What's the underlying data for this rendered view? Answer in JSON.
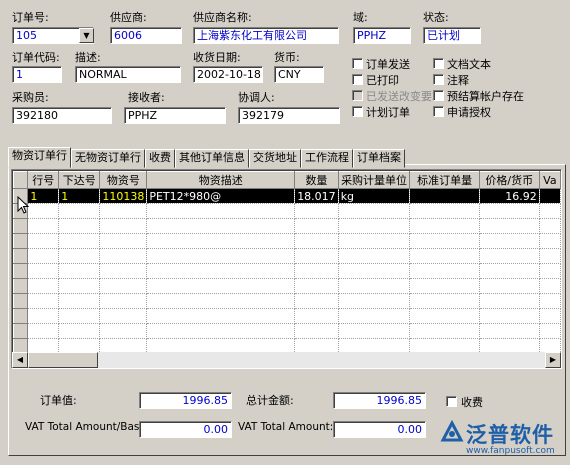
{
  "header": {
    "order_no": {
      "label": "订单号:",
      "value": "105"
    },
    "supplier": {
      "label": "供应商:",
      "value": "6006"
    },
    "supplier_name": {
      "label": "供应商名称:",
      "value": "上海紫东化工有限公司"
    },
    "domain": {
      "label": "域:",
      "value": "PPHZ"
    },
    "status": {
      "label": "状态:",
      "value": "已计划"
    },
    "order_code": {
      "label": "订单代码:",
      "value": "1"
    },
    "description": {
      "label": "描述:",
      "value": "NORMAL"
    },
    "receipt_date": {
      "label": "收货日期:",
      "value": "2002-10-18"
    },
    "currency": {
      "label": "货币:",
      "value": "CNY"
    },
    "buyer": {
      "label": "采购员:",
      "value": "392180"
    },
    "receiver": {
      "label": "接收者:",
      "value": "PPHZ"
    },
    "coordinator": {
      "label": "协调人:",
      "value": "392179"
    }
  },
  "checkboxes": [
    {
      "label": "订单发送",
      "checked": false,
      "disabled": false
    },
    {
      "label": "文档文本",
      "checked": false,
      "disabled": false
    },
    {
      "label": "已打印",
      "checked": false,
      "disabled": false
    },
    {
      "label": "注释",
      "checked": false,
      "disabled": false
    },
    {
      "label": "已发送改变要求",
      "checked": false,
      "disabled": true
    },
    {
      "label": "预结算帐户存在",
      "checked": false,
      "disabled": false
    },
    {
      "label": "计划订单",
      "checked": false,
      "disabled": false
    },
    {
      "label": "申请授权",
      "checked": false,
      "disabled": false
    }
  ],
  "tabs": [
    "物资订单行",
    "无物资订单行",
    "收费",
    "其他订单信息",
    "交货地址",
    "工作流程",
    "订单档案"
  ],
  "table": {
    "columns": [
      "行号",
      "下达号",
      "物资号",
      "物资描述",
      "数量",
      "采购计量单位",
      "标准订单量",
      "价格/货币",
      "Va"
    ],
    "rows": [
      [
        "1",
        "1",
        "110138",
        "PET12*980@",
        "18.017",
        "kg",
        "",
        "16.92",
        ""
      ]
    ]
  },
  "footer": {
    "order_value": {
      "label": "订单值:",
      "value": "1996.85"
    },
    "total_amount": {
      "label": "总计金额:",
      "value": "1996.85"
    },
    "charge": {
      "label": "收费"
    },
    "vat_total_base": {
      "label": "VAT Total Amount/Base:",
      "value": "0.00"
    },
    "vat_total": {
      "label": "VAT Total Amount:",
      "value": "0.00"
    }
  },
  "logo": {
    "name": "泛普软件",
    "url": "www.fanpusoft.com"
  },
  "colors": {
    "selected_row_bg": "#000000",
    "material_no_text": "#ffff00",
    "value_blue": "#0000cc",
    "logo_blue": "#1f5fa8"
  }
}
